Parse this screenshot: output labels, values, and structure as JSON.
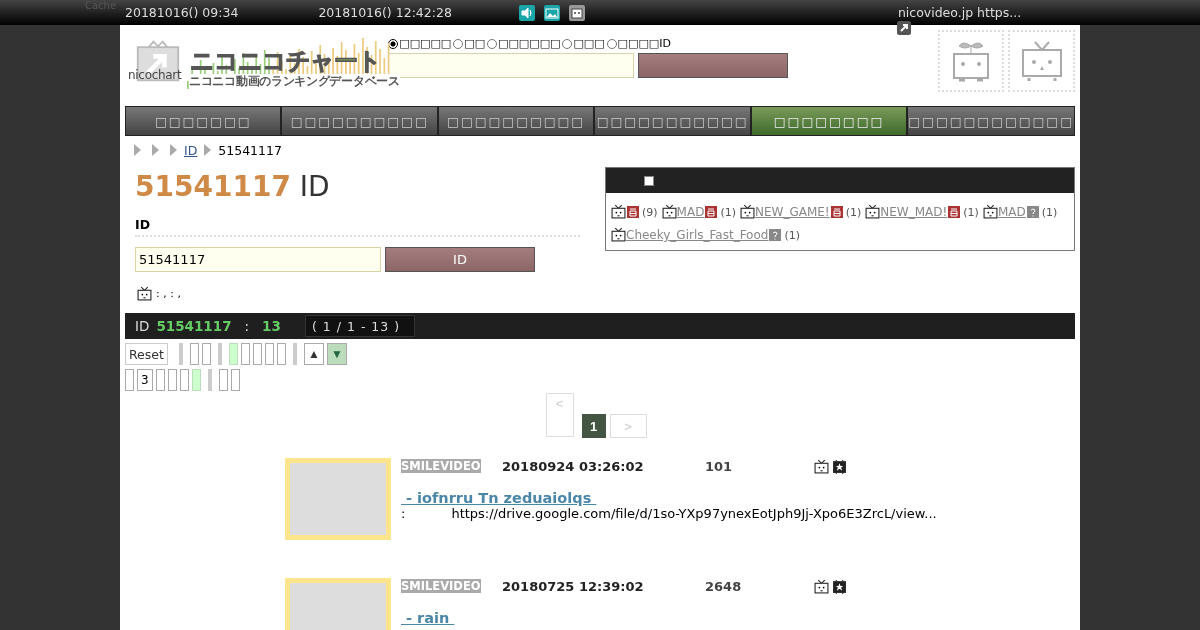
{
  "top_bar": {
    "cache": "Cache",
    "login_time": "20181016() 09:34",
    "now_time": "20181016() 12:42:28",
    "site_link": "nicovideo.jp https..."
  },
  "logo": {
    "brand": "nicochart",
    "title": "ニコニコチャート",
    "subtitle": "ニコニコ動画のランキングデータベース"
  },
  "search": {
    "options": [
      {
        "label": "□□□□□",
        "selected": true
      },
      {
        "label": "□□",
        "selected": false
      },
      {
        "label": "□□□□□□",
        "selected": false
      },
      {
        "label": "□□□",
        "selected": false
      },
      {
        "label": "□□□□ID",
        "selected": false
      }
    ]
  },
  "nav": [
    {
      "label": "□□□□□□□",
      "selected": false
    },
    {
      "label": "□□□□□□□□□□",
      "selected": false
    },
    {
      "label": "□□□□□□□□□□",
      "selected": false
    },
    {
      "label": "□□□□□□□□□□□",
      "selected": false
    },
    {
      "label": "□□□□□□□□",
      "selected": true
    },
    {
      "label": "□□□□□□□□□□□□",
      "selected": false
    }
  ],
  "breadcrumb": [
    {
      "label": "ID",
      "link": true
    },
    {
      "label": "51541117",
      "link": false
    }
  ],
  "heading": {
    "id": "51541117",
    "suffix": "ID"
  },
  "id_form": {
    "label": "ID",
    "value": "51541117",
    "button": "ID",
    "note": ": , : ,"
  },
  "tag_panel": {
    "checked": false,
    "tags": [
      {
        "count": "(9)",
        "locked": true
      },
      {
        "name": "MAD",
        "count": "(1)",
        "locked": true
      },
      {
        "name": "NEW_GAME!",
        "count": "(1)",
        "locked": true
      },
      {
        "name": "NEW_MAD!",
        "count": "(1)",
        "locked": true
      },
      {
        "name": "MAD",
        "count": "(1)",
        "locked": false
      },
      {
        "name": "Cheeky_Girls_Fast_Food",
        "count": "(1)",
        "locked": false
      }
    ]
  },
  "result_bar": {
    "prefix": "ID",
    "id": "51541117",
    "sep": ":",
    "total": "13",
    "range": "( 1 / 1 - 13 )"
  },
  "sort_rows": [
    [
      {
        "kind": "reset",
        "label": "Reset"
      },
      {
        "kind": "separator"
      },
      {
        "kind": "option",
        "selected": false
      },
      {
        "kind": "option",
        "selected": false
      },
      {
        "kind": "separator"
      },
      {
        "kind": "option",
        "selected": true
      },
      {
        "kind": "option",
        "selected": false
      },
      {
        "kind": "option",
        "selected": false
      },
      {
        "kind": "option",
        "selected": false
      },
      {
        "kind": "option",
        "selected": false
      },
      {
        "kind": "separator"
      },
      {
        "kind": "order",
        "label": "▲",
        "selected": false
      },
      {
        "kind": "order",
        "label": "▼",
        "selected": true
      }
    ],
    [
      {
        "kind": "option",
        "selected": false
      },
      {
        "kind": "option",
        "label": "3",
        "selected": false
      },
      {
        "kind": "option",
        "selected": false
      },
      {
        "kind": "option",
        "selected": false
      },
      {
        "kind": "option",
        "selected": false
      },
      {
        "kind": "option",
        "selected": true
      },
      {
        "kind": "separator"
      },
      {
        "kind": "option",
        "selected": false
      },
      {
        "kind": "option",
        "selected": false
      }
    ]
  ],
  "pagination": {
    "prev": "<",
    "next": ">",
    "pages": [
      {
        "label": "1",
        "selected": true
      }
    ]
  },
  "videos": [
    {
      "source": "SMILEVIDEO",
      "date": "20180924 03:26:02",
      "views": "101",
      "title": " - iofnrru Tn zeduaiolqs ",
      "desc_label": ":",
      "desc": "https://drive.google.com/file/d/1so-YXp97ynexEotJph9Jj-Xpo6E3ZrcL/view..."
    },
    {
      "source": "SMILEVIDEO",
      "date": "20180725 12:39:02",
      "views": "2648",
      "title": " - rain "
    }
  ]
}
